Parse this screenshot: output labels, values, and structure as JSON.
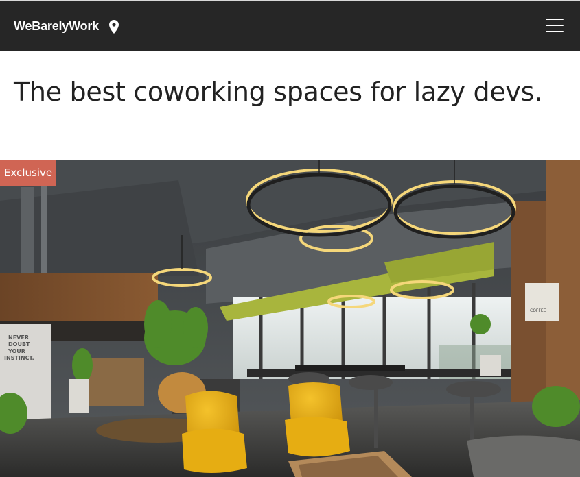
{
  "header": {
    "brand": "WeBarelyWork",
    "location_icon": "map-pin-icon",
    "menu_icon": "hamburger-menu-icon",
    "background": "#262626"
  },
  "hero": {
    "title": "The best coworking spaces for lazy devs."
  },
  "listing": {
    "badge": "Exclusive",
    "badge_color": "#d06554",
    "image_alt": "coworking space photo",
    "wall_signs": {
      "motto": "NEVER DOUBT YOUR INSTINCT.",
      "menu_board": "COFFEE"
    }
  }
}
